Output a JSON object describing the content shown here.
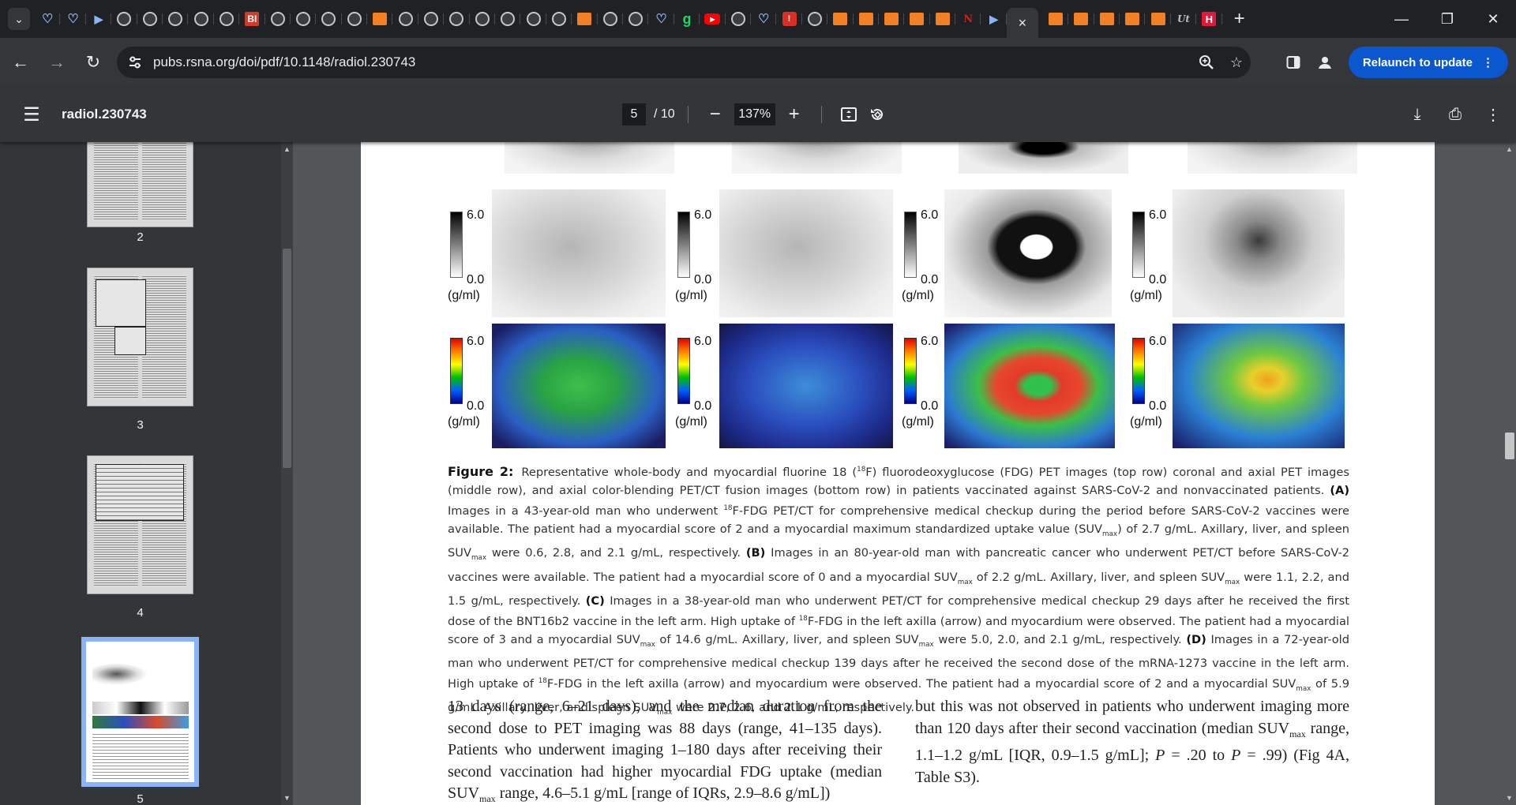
{
  "tabs": {
    "menu_icon": "chevron-down-icon",
    "favicons": [
      "shield",
      "shield",
      "play",
      "globe",
      "globe",
      "globe",
      "globe",
      "globe",
      "bi",
      "globe",
      "globe",
      "globe",
      "globe",
      "orange",
      "globe",
      "globe",
      "globe",
      "globe",
      "globe",
      "globe",
      "globe",
      "orange",
      "globe",
      "globe",
      "shield",
      "g",
      "yt",
      "globe",
      "shield",
      "red",
      "globe",
      "orange",
      "orange",
      "orange",
      "orange",
      "orange",
      "nyt",
      "play"
    ],
    "favicons_right": [
      "orange",
      "orange",
      "orange",
      "orange",
      "orange",
      "wp",
      "h"
    ],
    "active_close": "×",
    "new_tab": "+"
  },
  "window": {
    "minimize": "—",
    "maximize": "❐",
    "close": "✕"
  },
  "toolbar": {
    "back": "←",
    "forward": "→",
    "reload": "↻",
    "site_info_icon": "tune-icon",
    "url": "pubs.rsna.org/doi/pdf/10.1148/radiol.230743",
    "relaunch_label": "Relaunch to update",
    "relaunch_color": "#0b57d0"
  },
  "pdf": {
    "title": "radiol.230743",
    "page_current": "5",
    "page_total": "/ 10",
    "zoom": "137%"
  },
  "sidebar": {
    "thumbnails": [
      {
        "label": "2"
      },
      {
        "label": "3"
      },
      {
        "label": "4"
      },
      {
        "label": "5",
        "active": true
      }
    ]
  },
  "figure": {
    "colorbar_max": "6.0",
    "colorbar_min": "0.0",
    "colorbar_unit": "(g/ml)",
    "caption_label": "Figure 2:",
    "caption_parts": [
      {
        "t": "Representative whole-body and myocardial fluorine 18 ("
      },
      {
        "t": "18",
        "sup": true
      },
      {
        "t": "F) fluorodeoxyglucose (FDG) PET images (top row) coronal and axial PET images (middle row), and axial color-blending PET/CT fusion images (bottom row) in patients vaccinated against SARS-CoV-2 and nonvaccinated patients. "
      },
      {
        "t": "(A)",
        "b": true
      },
      {
        "t": " Images in a 43-year-old man who underwent "
      },
      {
        "t": "18",
        "sup": true
      },
      {
        "t": "F-FDG PET/CT for comprehensive medical checkup during the period before SARS-CoV-2 vaccines were available. The patient had a myocardial score of 2 and a myocardial maximum standardized uptake value (SUV"
      },
      {
        "t": "max",
        "sub": true
      },
      {
        "t": ") of 2.7 g/mL. Axillary, liver, and spleen SUV"
      },
      {
        "t": "max",
        "sub": true
      },
      {
        "t": " were 0.6, 2.8, and 2.1 g/mL, respectively. "
      },
      {
        "t": "(B)",
        "b": true
      },
      {
        "t": " Images in an 80-year-old man with pancreatic cancer who underwent PET/CT before SARS-CoV-2 vaccines were available. The patient had a myocardial score of 0 and a myocardial SUV"
      },
      {
        "t": "max",
        "sub": true
      },
      {
        "t": " of 2.2 g/mL. Axillary, liver, and spleen SUV"
      },
      {
        "t": "max",
        "sub": true
      },
      {
        "t": " were 1.1, 2.2, and 1.5 g/mL, respectively. "
      },
      {
        "t": "(C)",
        "b": true
      },
      {
        "t": " Images in a 38-year-old man who underwent PET/CT for comprehensive medical checkup 29 days after he received the first dose of the BNT16b2 vaccine in the left arm. High uptake of "
      },
      {
        "t": "18",
        "sup": true
      },
      {
        "t": "F-FDG in the left axilla (arrow) and myocardium were observed. The patient had a myocardial score of 3 and a myocardial SUV"
      },
      {
        "t": "max",
        "sub": true
      },
      {
        "t": " of 14.6 g/mL. Axillary, liver, and spleen SUV"
      },
      {
        "t": "max",
        "sub": true
      },
      {
        "t": " were 5.0, 2.0, and 2.1 g/mL, respectively. "
      },
      {
        "t": "(D)",
        "b": true
      },
      {
        "t": " Images in a 72-year-old man who underwent PET/CT for comprehensive medical checkup 139 days after he received the second dose of the mRNA-1273 vaccine in the left arm. High uptake of "
      },
      {
        "t": "18",
        "sup": true
      },
      {
        "t": "F-FDG in the left axilla (arrow) and myocardium were observed. The patient had a myocardial score of 2 and a myocardial SUV"
      },
      {
        "t": "max",
        "sub": true
      },
      {
        "t": " of 5.9 g/mL. Axillary, liver, and spleen SUV"
      },
      {
        "t": "max",
        "sub": true
      },
      {
        "t": " were 2.7, 2.6, and 2.1 g/mL, respectively."
      }
    ]
  },
  "body": {
    "left_parts": [
      {
        "t": "13 days (range, 6–21 days), and the median duration from the second dose to PET imaging was 88 days (range, 41–135 days). Patients who underwent imaging 1–180 days after receiving their second vaccination had higher myocardial FDG uptake (median SUV"
      },
      {
        "t": "max",
        "sub": true
      },
      {
        "t": " range, 4.6–5.1 g/mL [range of IQRs, 2.9–8.6 g/mL])"
      }
    ],
    "right_parts": [
      {
        "t": "but this was not observed in patients who underwent imaging more than 120 days after their second vaccination (median SUV"
      },
      {
        "t": "max",
        "sub": true
      },
      {
        "t": " range, 1.1–1.2 g/mL [IQR, 0.9–1.5 g/mL]; "
      },
      {
        "t": "P",
        "i": true
      },
      {
        "t": " = .20 to "
      },
      {
        "t": "P",
        "i": true
      },
      {
        "t": " = .99) (Fig 4A, Table S3)."
      }
    ]
  }
}
